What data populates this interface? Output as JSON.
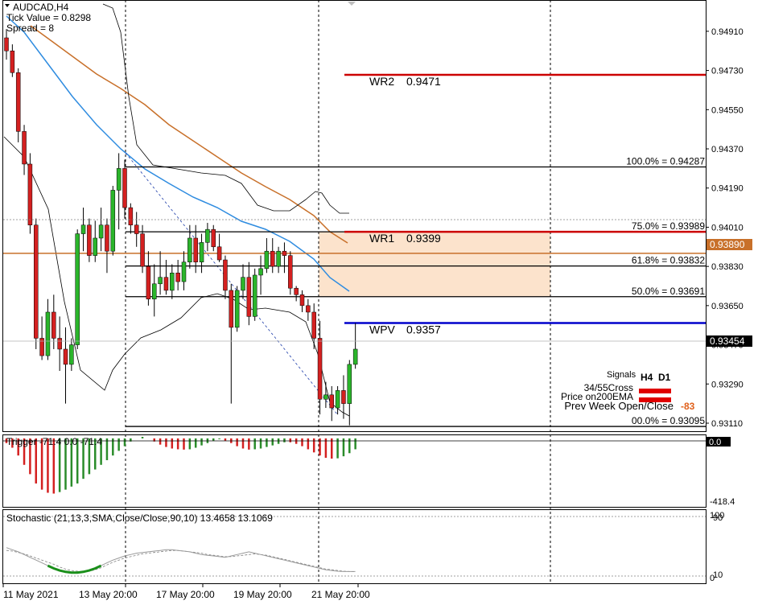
{
  "header": {
    "symbol": "AUDCAD,H4",
    "tick_value": "Tick Value = 0.8298",
    "spread": "Spread = 8"
  },
  "chart_data": [
    {
      "type": "candlestick",
      "symbol": "AUDCAD",
      "timeframe": "H4",
      "y_ticks": [
        0.9491,
        0.9473,
        0.9455,
        0.9437,
        0.9419,
        0.9401,
        0.9383,
        0.9365,
        0.9347,
        0.9329,
        0.9311
      ],
      "y_tick_labels": [
        "0.94910",
        "0.94730",
        "0.94550",
        "0.94370",
        "0.94190",
        "0.94010",
        "0.93830",
        "0.93650",
        "0.93470",
        "0.93290",
        "0.93110"
      ],
      "ylim": [
        0.93073,
        0.9505
      ],
      "x_labels": [
        "11 May 2021",
        "13 May 20:00",
        "17 May 20:00",
        "19 May 20:00",
        "21 May 20:00"
      ],
      "current_price": "0.93454",
      "ema200_price": "0.93890",
      "candles": [
        [
          0.9488,
          0.9492,
          0.9478,
          0.9482
        ],
        [
          0.9482,
          0.9485,
          0.947,
          0.9472
        ],
        [
          0.9472,
          0.9474,
          0.944,
          0.9445
        ],
        [
          0.9445,
          0.9448,
          0.9425,
          0.943
        ],
        [
          0.943,
          0.9435,
          0.9398,
          0.9402
        ],
        [
          0.9402,
          0.9405,
          0.9345,
          0.935
        ],
        [
          0.935,
          0.936,
          0.934,
          0.9342
        ],
        [
          0.9342,
          0.9368,
          0.934,
          0.9362
        ],
        [
          0.9362,
          0.937,
          0.9345,
          0.935
        ],
        [
          0.935,
          0.936,
          0.9335,
          0.9345
        ],
        [
          0.9345,
          0.9355,
          0.932,
          0.9338
        ],
        [
          0.9338,
          0.935,
          0.9335,
          0.9347
        ],
        [
          0.9347,
          0.94,
          0.9345,
          0.9398
        ],
        [
          0.9398,
          0.941,
          0.939,
          0.9402
        ],
        [
          0.9402,
          0.9405,
          0.9385,
          0.9388
        ],
        [
          0.9388,
          0.9404,
          0.9385,
          0.9396
        ],
        [
          0.9396,
          0.941,
          0.939,
          0.9402
        ],
        [
          0.9402,
          0.9405,
          0.938,
          0.939
        ],
        [
          0.939,
          0.942,
          0.9388,
          0.9418
        ],
        [
          0.9418,
          0.9435,
          0.94,
          0.9428
        ],
        [
          0.9428,
          0.9432,
          0.9405,
          0.941
        ],
        [
          0.941,
          0.9412,
          0.9398,
          0.9402
        ],
        [
          0.9402,
          0.9408,
          0.9392,
          0.9398
        ],
        [
          0.9398,
          0.9402,
          0.938,
          0.9383
        ],
        [
          0.9383,
          0.939,
          0.9365,
          0.9368
        ],
        [
          0.9368,
          0.9384,
          0.936,
          0.9375
        ],
        [
          0.9375,
          0.939,
          0.937,
          0.9378
        ],
        [
          0.9378,
          0.9386,
          0.937,
          0.9372
        ],
        [
          0.9372,
          0.9384,
          0.9368,
          0.938
        ],
        [
          0.938,
          0.9386,
          0.9372,
          0.9376
        ],
        [
          0.9376,
          0.939,
          0.9372,
          0.9385
        ],
        [
          0.9385,
          0.9402,
          0.9382,
          0.9396
        ],
        [
          0.9396,
          0.9402,
          0.938,
          0.9385
        ],
        [
          0.9385,
          0.9398,
          0.938,
          0.9394
        ],
        [
          0.9394,
          0.9403,
          0.939,
          0.94
        ],
        [
          0.94,
          0.9402,
          0.939,
          0.9392
        ],
        [
          0.9392,
          0.9398,
          0.9385,
          0.9386
        ],
        [
          0.9386,
          0.9388,
          0.9368,
          0.9372
        ],
        [
          0.9372,
          0.9375,
          0.932,
          0.9355
        ],
        [
          0.9355,
          0.9374,
          0.9353,
          0.9372
        ],
        [
          0.9372,
          0.9384,
          0.9368,
          0.9378
        ],
        [
          0.9378,
          0.9385,
          0.9356,
          0.936
        ],
        [
          0.936,
          0.9382,
          0.9358,
          0.9379
        ],
        [
          0.9379,
          0.9388,
          0.937,
          0.9382
        ],
        [
          0.9382,
          0.9396,
          0.938,
          0.939
        ],
        [
          0.939,
          0.9396,
          0.938,
          0.9383
        ],
        [
          0.9383,
          0.9392,
          0.938,
          0.939
        ],
        [
          0.939,
          0.9394,
          0.938,
          0.9388
        ],
        [
          0.9388,
          0.939,
          0.937,
          0.9373
        ],
        [
          0.9373,
          0.9374,
          0.9367,
          0.937
        ],
        [
          0.937,
          0.9372,
          0.9362,
          0.9365
        ],
        [
          0.9365,
          0.9368,
          0.9358,
          0.9362
        ],
        [
          0.9362,
          0.9366,
          0.9345,
          0.935
        ],
        [
          0.935,
          0.9358,
          0.9315,
          0.9322
        ],
        [
          0.9322,
          0.933,
          0.9318,
          0.9324
        ],
        [
          0.9324,
          0.9328,
          0.9312,
          0.9318
        ],
        [
          0.9318,
          0.9328,
          0.9315,
          0.9326
        ],
        [
          0.9326,
          0.9333,
          0.9313,
          0.932
        ],
        [
          0.932,
          0.934,
          0.931,
          0.9338
        ],
        [
          0.9338,
          0.9357,
          0.9336,
          0.9345
        ]
      ],
      "levels": [
        {
          "label": "WR2",
          "value": "0.9471",
          "price": 0.9471,
          "color": "#cc0000"
        },
        {
          "label": "WR1",
          "value": "0.9399",
          "price": 0.93989,
          "color": "#cc0000"
        },
        {
          "label": "WPV",
          "value": "0.9357",
          "price": 0.9357,
          "color": "#0000cc"
        }
      ],
      "fibonacci": [
        {
          "label": "100.0% = 0.94287",
          "price": 0.94287
        },
        {
          "label": "75.0% = 0.93989",
          "price": 0.93989
        },
        {
          "label": "61.8% = 0.93832",
          "price": 0.93832
        },
        {
          "label": "50.0% = 0.93691",
          "price": 0.93691
        },
        {
          "label": "00.0% = 0.93095",
          "price": 0.93095
        }
      ],
      "zone": {
        "top": 0.93989,
        "bottom": 0.93691,
        "color": "#fce3cc"
      },
      "signals": {
        "title": "Signals",
        "columns": [
          "H4",
          "D1"
        ],
        "rows": [
          "34/55Cross",
          "Price on200EMA",
          "Prev Week Open/Close"
        ],
        "value": "-83"
      }
    },
    {
      "type": "bar",
      "name": "Trigger",
      "title": "Trigger -71.4 0.0 -71.4",
      "y_tick_labels": [
        "0.0",
        "-418.4"
      ],
      "ylim": [
        -430,
        10
      ],
      "values": [
        -30,
        -60,
        -110,
        -170,
        -230,
        -290,
        -330,
        -350,
        -355,
        -345,
        -330,
        -310,
        -290,
        -260,
        -230,
        -200,
        -170,
        -140,
        -110,
        -80,
        -50,
        -20,
        0,
        10,
        0,
        -20,
        -40,
        -55,
        -65,
        -70,
        -72,
        -70,
        -60,
        -45,
        -30,
        -15,
        -5,
        -15,
        -30,
        -50,
        -65,
        -72,
        -70,
        -65,
        -55,
        -45,
        -35,
        -25,
        -25,
        -35,
        -50,
        -70,
        -90,
        -110,
        -125,
        -130,
        -128,
        -115,
        -95,
        -70
      ],
      "colors": [
        "red",
        "red",
        "red",
        "red",
        "red",
        "red",
        "red",
        "red",
        "red",
        "green",
        "green",
        "green",
        "green",
        "green",
        "green",
        "green",
        "green",
        "green",
        "green",
        "green",
        "green",
        "green",
        "green",
        "green",
        "red",
        "red",
        "red",
        "red",
        "red",
        "red",
        "red",
        "green",
        "green",
        "green",
        "green",
        "green",
        "green",
        "red",
        "red",
        "red",
        "red",
        "red",
        "green",
        "green",
        "green",
        "green",
        "green",
        "green",
        "red",
        "red",
        "red",
        "red",
        "red",
        "red",
        "red",
        "red",
        "green",
        "green",
        "green",
        "green"
      ]
    },
    {
      "type": "line",
      "name": "Stochastic",
      "title": "Stochastic (21,13,3,SMA,Close/Close,90,10) 13.4658 13.1069",
      "y_tick_labels": [
        "100",
        "90",
        "10",
        "0"
      ],
      "ylim": [
        0,
        100
      ],
      "main": [
        48,
        45,
        42,
        38,
        34,
        30,
        26,
        22,
        18,
        15,
        13,
        12,
        12,
        13,
        15,
        18,
        22,
        26,
        30,
        33,
        36,
        38,
        40,
        41,
        42,
        43,
        44,
        45,
        45,
        44,
        43,
        42,
        40,
        38,
        37,
        36,
        35,
        34,
        36,
        38,
        40,
        42,
        40,
        38,
        36,
        34,
        32,
        30,
        28,
        26,
        24,
        22,
        20,
        18,
        16,
        15,
        14,
        13.5,
        13.4658,
        13.4658
      ],
      "signal": [
        44,
        43,
        41,
        39,
        36,
        33,
        30,
        27,
        24,
        20,
        17,
        15,
        14,
        13,
        14,
        16,
        19,
        23,
        27,
        30,
        33,
        35,
        37,
        39,
        40,
        41,
        42,
        43,
        44,
        44,
        43,
        42,
        41,
        40,
        38,
        37,
        36,
        35,
        35,
        36,
        37,
        38,
        39,
        38,
        37,
        35,
        33,
        31,
        29,
        27,
        25,
        23,
        21,
        19,
        17,
        16,
        15,
        14,
        13.5,
        13.1069
      ],
      "main_color_low": "#1a8f1a"
    }
  ]
}
